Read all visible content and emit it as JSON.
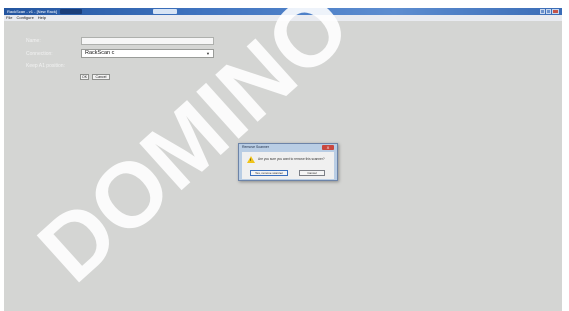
{
  "window": {
    "title": "RackScan - v1 - [New Rack]",
    "menu": [
      "File",
      "Configure",
      "Help"
    ]
  },
  "form": {
    "name_label": "Name:",
    "name_value": "",
    "connection_label": "Connection:",
    "connection_value": "RackScan c",
    "keep_label": "Keep A1 position:",
    "ok_label": "OK",
    "cancel_label": "Cancel"
  },
  "dialog": {
    "title": "Remove Scanner",
    "close_label": "X",
    "message": "Are you sure you want to remove this scanner?",
    "yes_label": "Yes, remove scanner",
    "cancel_label": "Cancel"
  },
  "watermark": {
    "text": "DOMINO",
    "color": "#ffffff"
  },
  "colors": {
    "app_background": "#d4d5d3",
    "titlebar": "#3f73bf",
    "dialog_frame": "#b9cde4",
    "warning": "#f0c419"
  }
}
